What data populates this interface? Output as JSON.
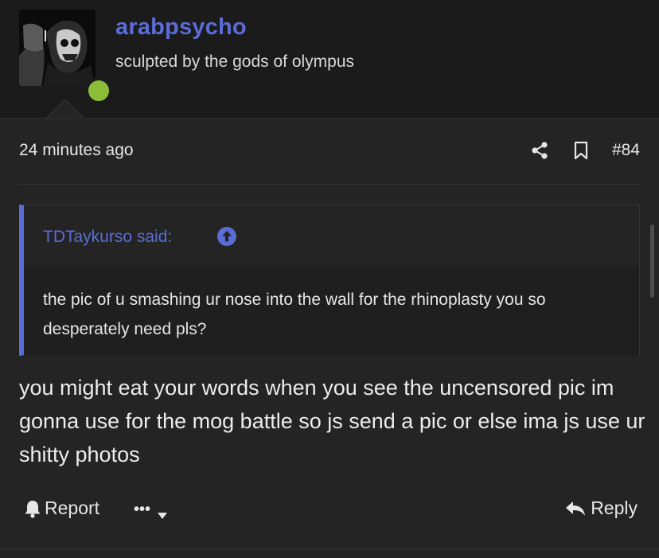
{
  "user": {
    "name": "arabpsycho",
    "title": "sculpted by the gods of olympus",
    "status": "online"
  },
  "post": {
    "time": "24 minutes ago",
    "number": "#84",
    "quote": {
      "author": "TDTaykurso said:",
      "text": "the pic of u smashing ur nose into the wall for the rhinoplasty you so desperately need pls?"
    },
    "body": "you might eat your words when you see the uncensored pic im gonna use for the mog battle so js send a pic or else ima js use ur shitty photos"
  },
  "actions": {
    "report": "Report",
    "more": "•••",
    "reply": "Reply"
  },
  "colors": {
    "background": "#1b1b1b",
    "message_background": "#242424",
    "accent": "#5b6cd6",
    "online": "#8cbd3a",
    "text": "#e6e6e6"
  },
  "icons": [
    "share-icon",
    "bookmark-icon",
    "quote-arrow-icon",
    "bell-icon",
    "caret-down-icon",
    "reply-icon"
  ]
}
